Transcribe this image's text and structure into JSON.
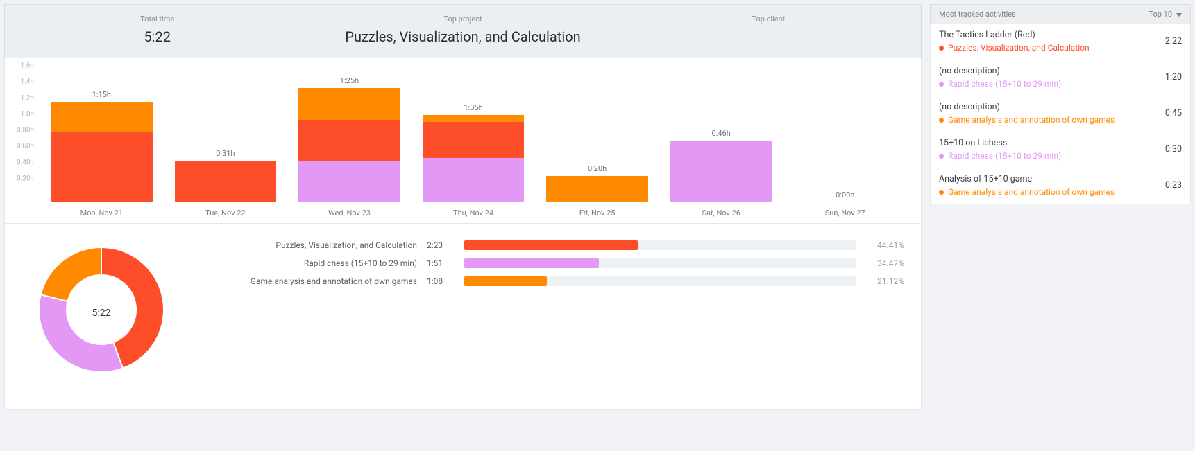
{
  "summary": {
    "total_time_label": "Total time",
    "total_time_value": "5:22",
    "top_project_label": "Top project",
    "top_project_value": "Puzzles, Visualization, and Calculation",
    "top_client_label": "Top client",
    "top_client_value": ""
  },
  "chart_data": {
    "type": "bar",
    "stacked": true,
    "ylabel": "",
    "y_ticks": [
      "0.20h",
      "0.40h",
      "0.60h",
      "0.80h",
      "1.0h",
      "1.2h",
      "1.4h",
      "1.6h"
    ],
    "ylim": [
      0,
      1.6
    ],
    "categories": [
      "Mon, Nov 21",
      "Tue, Nov 22",
      "Wed, Nov 23",
      "Thu, Nov 24",
      "Fri, Nov 25",
      "Sat, Nov 26",
      "Sun, Nov 27"
    ],
    "totals_label": [
      "1:15h",
      "0:31h",
      "1:25h",
      "1:05h",
      "0:20h",
      "0:46h",
      "0:00h"
    ],
    "series": [
      {
        "name": "Puzzles, Visualization, and Calculation",
        "color": "#fe4e29",
        "values": [
          0.88,
          0.52,
          0.5,
          0.45,
          0.0,
          0.0,
          0.0
        ]
      },
      {
        "name": "Rapid chess (15+10 to 29 min)",
        "color": "#e498f5",
        "values": [
          0.0,
          0.0,
          0.52,
          0.55,
          0.0,
          0.77,
          0.0
        ]
      },
      {
        "name": "Game analysis and annotation of own games",
        "color": "#ff8a00",
        "values": [
          0.37,
          0.0,
          0.4,
          0.08,
          0.33,
          0.0,
          0.0
        ]
      }
    ]
  },
  "donut": {
    "center": "5:22",
    "slices": [
      {
        "name": "Puzzles, Visualization, and Calculation",
        "color": "#fe4e29",
        "pct": 44.41
      },
      {
        "name": "Rapid chess (15+10 to 29 min)",
        "color": "#e498f5",
        "pct": 34.47
      },
      {
        "name": "Game analysis and annotation of own games",
        "color": "#ff8a00",
        "pct": 21.12
      }
    ]
  },
  "breakdown_rows": [
    {
      "name": "Puzzles, Visualization, and Calculation",
      "time": "2:23",
      "pct": "44.41%",
      "pct_num": 44.41,
      "color": "#fe4e29"
    },
    {
      "name": "Rapid chess (15+10 to 29 min)",
      "time": "1:51",
      "pct": "34.47%",
      "pct_num": 34.47,
      "color": "#e498f5"
    },
    {
      "name": "Game analysis and annotation of own games",
      "time": "1:08",
      "pct": "21.12%",
      "pct_num": 21.12,
      "color": "#ff8a00"
    }
  ],
  "side": {
    "header_label": "Most tracked activities",
    "filter_label": "Top 10",
    "activities": [
      {
        "title": "The Tactics Ladder (Red)",
        "project": "Puzzles, Visualization, and Calculation",
        "color": "#fe4e29",
        "time": "2:22"
      },
      {
        "title": "(no description)",
        "project": "Rapid chess (15+10 to 29 min)",
        "color": "#e498f5",
        "time": "1:20"
      },
      {
        "title": "(no description)",
        "project": "Game analysis and annotation of own games",
        "color": "#ff8a00",
        "time": "0:45"
      },
      {
        "title": "15+10 on Lichess",
        "project": "Rapid chess (15+10 to 29 min)",
        "color": "#e498f5",
        "time": "0:30"
      },
      {
        "title": "Analysis of 15+10 game",
        "project": "Game analysis and annotation of own games",
        "color": "#ff8a00",
        "time": "0:23"
      }
    ]
  }
}
